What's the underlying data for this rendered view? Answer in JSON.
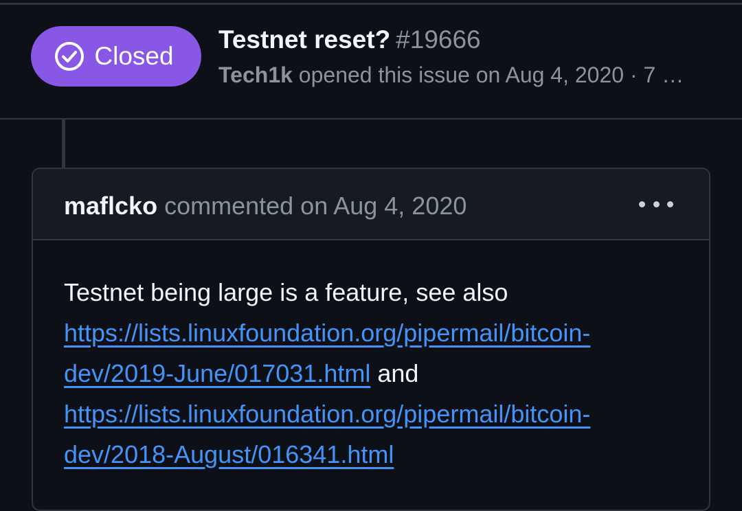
{
  "issue": {
    "state": "Closed",
    "title": "Testnet reset?",
    "number": "#19666",
    "author": "Tech1k",
    "meta_text": "opened this issue on Aug 4, 2020 · 7 …"
  },
  "comment": {
    "author": "maflcko",
    "meta_text": "commented on Aug 4, 2020",
    "body_intro": "Testnet being large is a feature, see also",
    "link1_line1": "https://lists.linuxfoundation.org/pipermail/bitcoin-",
    "link1_line2": "dev/2019-June/017031.html",
    "conjunction": "and",
    "link2_line1": "https://lists.linuxfoundation.org/pipermail/bitcoin-",
    "link2_line2": "dev/2018-August/016341.html"
  },
  "icons": {
    "state": "check-circle-icon",
    "menu": "kebab-menu-icon"
  },
  "colors": {
    "background": "#0d1117",
    "closed_badge": "#8957e5",
    "link": "#4493f8",
    "border": "#30363d"
  }
}
